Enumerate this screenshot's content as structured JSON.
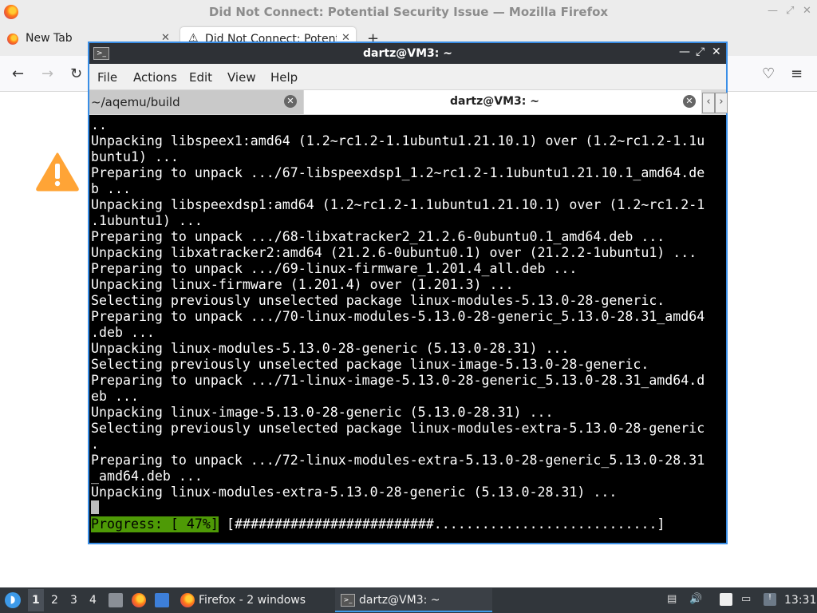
{
  "firefox": {
    "window_title": "Did Not Connect: Potential Security Issue — Mozilla Firefox",
    "tabs": [
      {
        "label": "New Tab"
      },
      {
        "label": "Did Not Connect: Potential Security Issue"
      }
    ],
    "new_tab_symbol": "+"
  },
  "terminal": {
    "title": "dartz@VM3: ~",
    "menu": [
      "File",
      "Actions",
      "Edit",
      "View",
      "Help"
    ],
    "tabs": [
      {
        "label": "~/aqemu/build"
      },
      {
        "label": "dartz@VM3: ~"
      }
    ],
    "lines": [
      "..",
      "Unpacking libspeex1:amd64 (1.2~rc1.2-1.1ubuntu1.21.10.1) over (1.2~rc1.2-1.1u",
      "buntu1) ...",
      "Preparing to unpack .../67-libspeexdsp1_1.2~rc1.2-1.1ubuntu1.21.10.1_amd64.de",
      "b ...",
      "Unpacking libspeexdsp1:amd64 (1.2~rc1.2-1.1ubuntu1.21.10.1) over (1.2~rc1.2-1",
      ".1ubuntu1) ...",
      "Preparing to unpack .../68-libxatracker2_21.2.6-0ubuntu0.1_amd64.deb ...",
      "Unpacking libxatracker2:amd64 (21.2.6-0ubuntu0.1) over (21.2.2-1ubuntu1) ...",
      "Preparing to unpack .../69-linux-firmware_1.201.4_all.deb ...",
      "Unpacking linux-firmware (1.201.4) over (1.201.3) ...",
      "Selecting previously unselected package linux-modules-5.13.0-28-generic.",
      "Preparing to unpack .../70-linux-modules-5.13.0-28-generic_5.13.0-28.31_amd64",
      ".deb ...",
      "Unpacking linux-modules-5.13.0-28-generic (5.13.0-28.31) ...",
      "Selecting previously unselected package linux-image-5.13.0-28-generic.",
      "Preparing to unpack .../71-linux-image-5.13.0-28-generic_5.13.0-28.31_amd64.d",
      "eb ...",
      "Unpacking linux-image-5.13.0-28-generic (5.13.0-28.31) ...",
      "Selecting previously unselected package linux-modules-extra-5.13.0-28-generic",
      ".",
      "Preparing to unpack .../72-linux-modules-extra-5.13.0-28-generic_5.13.0-28.31",
      "_amd64.deb ...",
      "Unpacking linux-modules-extra-5.13.0-28-generic (5.13.0-28.31) ..."
    ],
    "progress_label": "Progress: [ 47%]",
    "progress_bar": "[#########################............................]",
    "progress_percent": 47
  },
  "taskbar": {
    "workspaces": [
      "1",
      "2",
      "3",
      "4"
    ],
    "tasks": [
      {
        "label": "Firefox - 2 windows"
      },
      {
        "label": "dartz@VM3: ~"
      }
    ],
    "clock": "13:31"
  },
  "colors": {
    "accent_border": "#3a8ee6",
    "progress_green": "#4e9a06",
    "taskbar_bg": "#31363b",
    "warning_orange": "#ffa436"
  }
}
